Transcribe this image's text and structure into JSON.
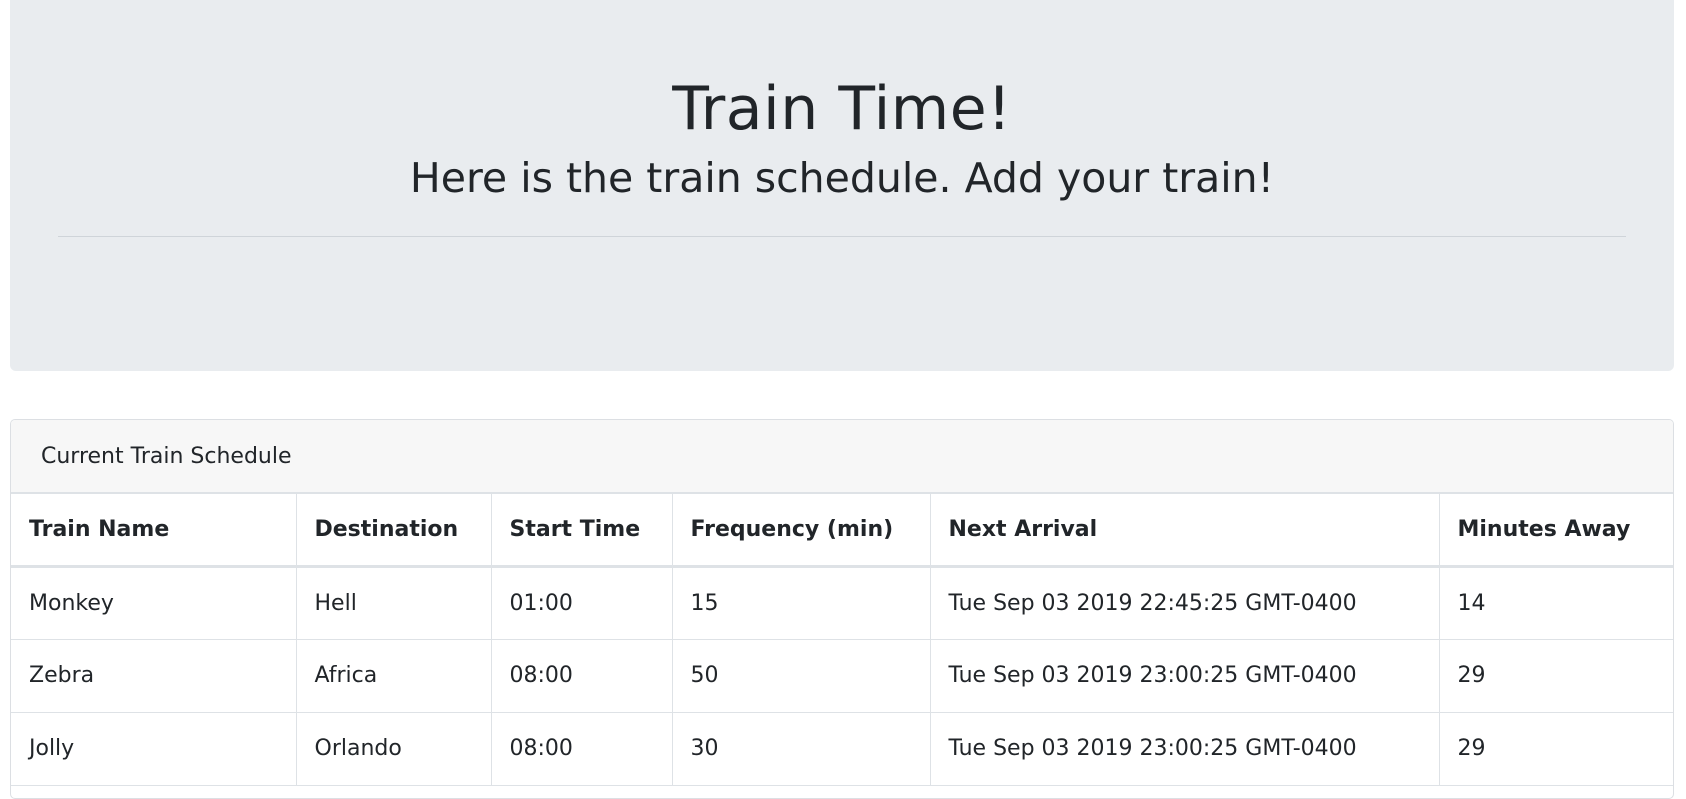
{
  "header": {
    "title": "Train Time!",
    "subtitle": "Here is the train schedule. Add your train!"
  },
  "schedule": {
    "heading": "Current Train Schedule",
    "columns": [
      "Train Name",
      "Destination",
      "Start Time",
      "Frequency (min)",
      "Next Arrival",
      "Minutes Away"
    ],
    "rows": [
      [
        "Monkey",
        "Hell",
        "01:00",
        "15",
        "Tue Sep 03 2019 22:45:25 GMT-0400",
        "14"
      ],
      [
        "Zebra",
        "Africa",
        "08:00",
        "50",
        "Tue Sep 03 2019 23:00:25 GMT-0400",
        "29"
      ],
      [
        "Jolly",
        "Orlando",
        "08:00",
        "30",
        "Tue Sep 03 2019 23:00:25 GMT-0400",
        "29"
      ]
    ]
  }
}
